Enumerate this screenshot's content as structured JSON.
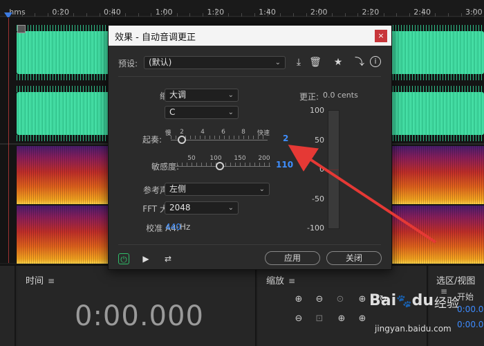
{
  "ruler": {
    "unit": "hms",
    "labels": [
      "0:20",
      "0:40",
      "1:00",
      "1:20",
      "1:40",
      "2:00",
      "2:20",
      "2:40",
      "3:00"
    ]
  },
  "dialog": {
    "title": "效果 - 自动音调更正",
    "close": "×",
    "preset_label": "预设:",
    "preset_value": "(默认)",
    "scale_label": "缩放:",
    "scale_value": "大调",
    "key_label": "调:",
    "key_value": "C",
    "attack_label": "起奏:",
    "attack_slow": "慢",
    "attack_fast": "快速",
    "attack_ticks": [
      "2",
      "4",
      "6",
      "8"
    ],
    "attack_value": "2",
    "sensitivity_label": "敏感度:",
    "sensitivity_ticks": [
      "50",
      "100",
      "150",
      "200"
    ],
    "sensitivity_value": "110",
    "reference_label": "参考声道:",
    "reference_value": "左侧",
    "fft_label": "FFT 大小:",
    "fft_value": "2048",
    "calibrate_label": "校准 A4:",
    "calibrate_value": "440",
    "calibrate_unit": "Hz",
    "correction_label": "更正:",
    "correction_value": "0.0 cents",
    "meter_ticks": [
      "100",
      "50",
      "0",
      "-50",
      "-100"
    ],
    "apply": "应用",
    "close_button": "关闭"
  },
  "panels": {
    "time_title": "时间",
    "time_value": "0:00.000",
    "zoom_title": "缩放",
    "selection_title": "选区/视图",
    "selection_start": "开始",
    "selection_values": [
      "0:00.000",
      "0:00.000"
    ],
    "menu_glyph": "≡"
  },
  "watermark": {
    "brand": "Bai",
    "brand_suffix": "du",
    "cn": "经验",
    "url": "jingyan.baidu.com"
  },
  "colors": {
    "waveform": "#3ed49b",
    "accent_blue": "#3f8fff",
    "arrow": "#e53935",
    "close_red": "#c8363a"
  }
}
